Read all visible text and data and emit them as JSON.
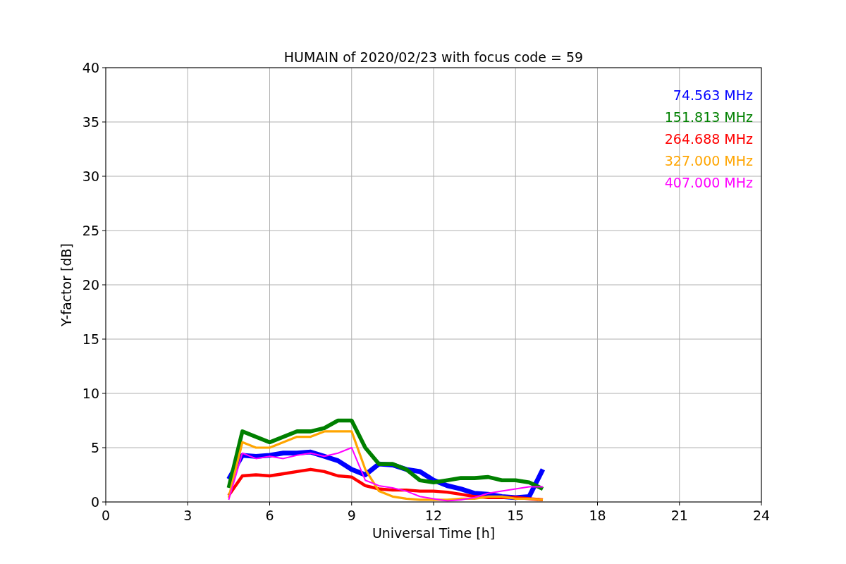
{
  "chart_data": {
    "type": "line",
    "title": "HUMAIN of 2020/02/23 with focus code = 59",
    "xlabel": "Universal Time [h]",
    "ylabel": "Y-factor [dB]",
    "x": [
      4.5,
      5,
      5.5,
      6,
      6.5,
      7,
      7.5,
      8,
      8.5,
      9,
      9.5,
      10,
      10.5,
      11,
      11.5,
      12,
      12.5,
      13,
      13.5,
      14,
      14.5,
      15,
      15.5,
      16
    ],
    "series": [
      {
        "name": "74.563 MHz",
        "color": "#0000ff",
        "values": [
          2.1,
          4.3,
          4.2,
          4.3,
          4.5,
          4.5,
          4.6,
          4.2,
          3.8,
          3.0,
          2.5,
          3.5,
          3.4,
          3.0,
          2.8,
          2.0,
          1.5,
          1.2,
          0.8,
          0.7,
          0.5,
          0.4,
          0.5,
          3.0
        ]
      },
      {
        "name": "151.813 MHz",
        "color": "#008000",
        "values": [
          1.3,
          6.5,
          6.0,
          5.5,
          6.0,
          6.5,
          6.5,
          6.8,
          7.5,
          7.5,
          5.0,
          3.5,
          3.5,
          3.0,
          2.0,
          1.8,
          2.0,
          2.2,
          2.2,
          2.3,
          2.0,
          2.0,
          1.8,
          1.2
        ]
      },
      {
        "name": "264.688 MHz",
        "color": "#ff0000",
        "values": [
          0.6,
          2.4,
          2.5,
          2.4,
          2.6,
          2.8,
          3.0,
          2.8,
          2.4,
          2.3,
          1.5,
          1.2,
          1.1,
          1.1,
          1.0,
          1.0,
          0.9,
          0.7,
          0.5,
          0.4,
          0.4,
          0.4,
          0.3,
          0.2
        ]
      },
      {
        "name": "327.000 MHz",
        "color": "#ffa500",
        "values": [
          0.4,
          5.5,
          5.0,
          5.0,
          5.5,
          6.0,
          6.0,
          6.5,
          6.5,
          6.5,
          3.0,
          1.0,
          0.5,
          0.3,
          0.2,
          0.2,
          0.2,
          0.3,
          0.3,
          0.5,
          0.5,
          0.3,
          0.3,
          0.2
        ]
      },
      {
        "name": "407.000 MHz",
        "color": "#ff00ff",
        "values": [
          0.2,
          4.5,
          4.0,
          4.2,
          4.0,
          4.3,
          4.5,
          4.2,
          4.5,
          5.0,
          2.0,
          1.5,
          1.3,
          1.0,
          0.5,
          0.3,
          0.1,
          0.2,
          0.4,
          0.8,
          1.0,
          1.2,
          1.4,
          1.4
        ]
      }
    ],
    "grid": true,
    "xlim": [
      0,
      24
    ],
    "ylim": [
      0,
      40
    ],
    "xticks": [
      0,
      3,
      6,
      9,
      12,
      15,
      18,
      21,
      24
    ],
    "yticks": [
      0,
      5,
      10,
      15,
      20,
      25,
      30,
      35,
      40
    ]
  }
}
